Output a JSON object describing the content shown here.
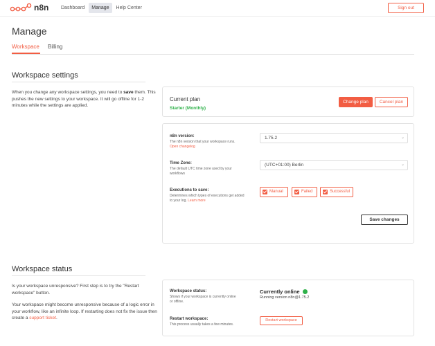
{
  "app": {
    "logo_text": "n8n",
    "brand_color": "#f25d43"
  },
  "nav": {
    "items": [
      {
        "label": "Dashboard",
        "active": false
      },
      {
        "label": "Manage",
        "active": true
      },
      {
        "label": "Help Center",
        "active": false
      }
    ],
    "signout_label": "Sign out"
  },
  "page": {
    "title": "Manage"
  },
  "tabs": [
    {
      "label": "Workspace",
      "active": true
    },
    {
      "label": "Billing",
      "active": false
    }
  ],
  "workspace_settings": {
    "title": "Workspace settings",
    "intro_before": "When you change any workspace settings, you need to ",
    "intro_bold": "save",
    "intro_after": " them. This pushes the new settings to your workspace. It will go offline for 1-2 minutes while the settings are applied."
  },
  "plan_card": {
    "label": "Current plan",
    "plan_name": "Starter (Monthly)",
    "change_plan_label": "Change plan",
    "cancel_plan_label": "Cancel plan"
  },
  "settings_card": {
    "version": {
      "label": "n8n version:",
      "desc": "The n8n version that your workspace runs.",
      "link": "Open changelog",
      "value": "1.75.2"
    },
    "timezone": {
      "label": "Time Zone:",
      "desc": "The default UTC time zone used by your workflows",
      "value": "(UTC+01:00) Berlin"
    },
    "executions": {
      "label": "Executions to save:",
      "desc": "Determines which types of executions get added to your log. ",
      "link": "Learn more",
      "options": [
        "Manual",
        "Failed",
        "Successful"
      ]
    },
    "save_label": "Save changes"
  },
  "workspace_status": {
    "title": "Workspace status",
    "para1": "Is your workspace unresponsive? First step is to try the \"Restart workspace\" button.",
    "para2_before": "Your workspace might become unresponsive because of a logic error in your workflow, like an infinite loop. If restarting does not fix the issue then create a ",
    "para2_link": "support ticket",
    "para2_after": "."
  },
  "status_card": {
    "status_label": "Workspace status:",
    "status_desc": "Shows if your workspace is currently online or offline.",
    "status_value": "Currently online",
    "status_color": "#2fb14a",
    "version_text": "Running version n8n@1.75.2",
    "restart_label": "Restart workspace:",
    "restart_desc": "This process usually takes a few minutes.",
    "restart_button": "Restart workspace"
  }
}
